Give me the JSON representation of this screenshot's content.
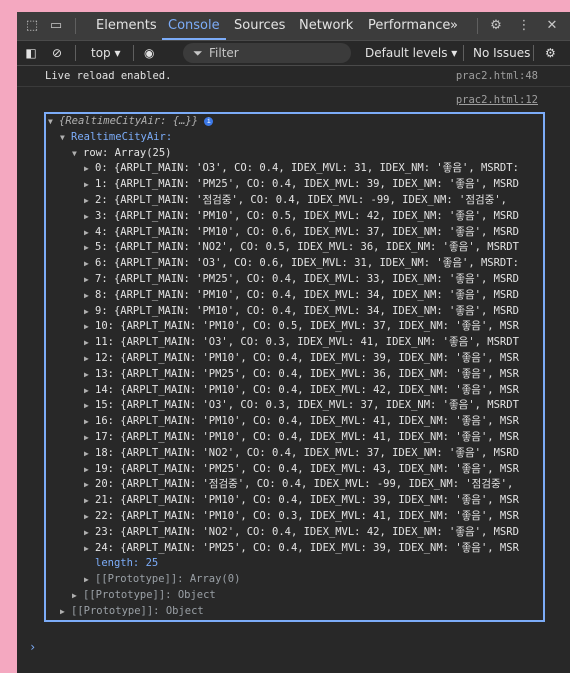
{
  "tabbar": {
    "tabs": [
      "Elements",
      "Console",
      "Sources",
      "Network",
      "Performance"
    ],
    "active": "Console",
    "more": "»"
  },
  "toolbar": {
    "context": "top",
    "filter_placeholder": "Filter",
    "levels": "Default levels",
    "issues": "No Issues"
  },
  "messages": [
    {
      "text": "Live reload enabled.",
      "source": "prac2.html:48"
    },
    {
      "text": "",
      "source": "prac2.html:12"
    }
  ],
  "object": {
    "summary": "{RealtimeCityAir: {…}}",
    "root_key": "RealtimeCityAir",
    "row_label": "row: Array(25)",
    "rows": [
      "0: {ARPLT_MAIN: 'O3', CO: 0.4, IDEX_MVL: 31, IDEX_NM: '좋음', MSRDT:",
      "1: {ARPLT_MAIN: 'PM25', CO: 0.4, IDEX_MVL: 39, IDEX_NM: '좋음', MSRD",
      "2: {ARPLT_MAIN: '점검중', CO: 0.4, IDEX_MVL: -99, IDEX_NM: '점검중',",
      "3: {ARPLT_MAIN: 'PM10', CO: 0.5, IDEX_MVL: 42, IDEX_NM: '좋음', MSRD",
      "4: {ARPLT_MAIN: 'PM10', CO: 0.6, IDEX_MVL: 37, IDEX_NM: '좋음', MSRD",
      "5: {ARPLT_MAIN: 'NO2', CO: 0.5, IDEX_MVL: 36, IDEX_NM: '좋음', MSRDT",
      "6: {ARPLT_MAIN: 'O3', CO: 0.6, IDEX_MVL: 31, IDEX_NM: '좋음', MSRDT:",
      "7: {ARPLT_MAIN: 'PM25', CO: 0.4, IDEX_MVL: 33, IDEX_NM: '좋음', MSRD",
      "8: {ARPLT_MAIN: 'PM10', CO: 0.4, IDEX_MVL: 34, IDEX_NM: '좋음', MSRD",
      "9: {ARPLT_MAIN: 'PM10', CO: 0.4, IDEX_MVL: 34, IDEX_NM: '좋음', MSRD",
      "10: {ARPLT_MAIN: 'PM10', CO: 0.5, IDEX_MVL: 37, IDEX_NM: '좋음', MSR",
      "11: {ARPLT_MAIN: 'O3', CO: 0.3, IDEX_MVL: 41, IDEX_NM: '좋음', MSRDT",
      "12: {ARPLT_MAIN: 'PM10', CO: 0.4, IDEX_MVL: 39, IDEX_NM: '좋음', MSR",
      "13: {ARPLT_MAIN: 'PM25', CO: 0.4, IDEX_MVL: 36, IDEX_NM: '좋음', MSR",
      "14: {ARPLT_MAIN: 'PM10', CO: 0.4, IDEX_MVL: 42, IDEX_NM: '좋음', MSR",
      "15: {ARPLT_MAIN: 'O3', CO: 0.3, IDEX_MVL: 37, IDEX_NM: '좋음', MSRDT",
      "16: {ARPLT_MAIN: 'PM10', CO: 0.4, IDEX_MVL: 41, IDEX_NM: '좋음', MSR",
      "17: {ARPLT_MAIN: 'PM10', CO: 0.4, IDEX_MVL: 41, IDEX_NM: '좋음', MSR",
      "18: {ARPLT_MAIN: 'NO2', CO: 0.4, IDEX_MVL: 37, IDEX_NM: '좋음', MSRD",
      "19: {ARPLT_MAIN: 'PM25', CO: 0.4, IDEX_MVL: 43, IDEX_NM: '좋음', MSR",
      "20: {ARPLT_MAIN: '점검중', CO: 0.4, IDEX_MVL: -99, IDEX_NM: '점검중',",
      "21: {ARPLT_MAIN: 'PM10', CO: 0.4, IDEX_MVL: 39, IDEX_NM: '좋음', MSR",
      "22: {ARPLT_MAIN: 'PM10', CO: 0.3, IDEX_MVL: 41, IDEX_NM: '좋음', MSR",
      "23: {ARPLT_MAIN: 'NO2', CO: 0.4, IDEX_MVL: 42, IDEX_NM: '좋음', MSRD",
      "24: {ARPLT_MAIN: 'PM25', CO: 0.4, IDEX_MVL: 39, IDEX_NM: '좋음', MSR"
    ],
    "length_label": "length: 25",
    "array_proto": "[[Prototype]]: Array(0)",
    "inner_proto": "[[Prototype]]: Object",
    "outer_proto": "[[Prototype]]: Object"
  },
  "prompt": "›"
}
